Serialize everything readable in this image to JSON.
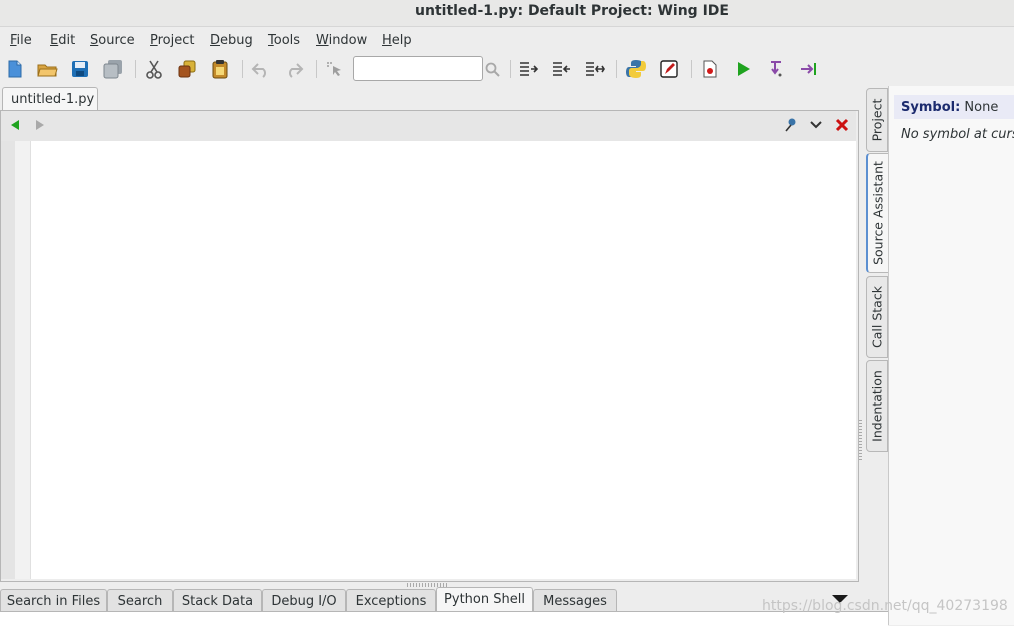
{
  "window": {
    "title": "untitled-1.py: Default Project: Wing IDE"
  },
  "menu": [
    {
      "label": "File",
      "ul": "F",
      "rest": "ile"
    },
    {
      "label": "Edit",
      "ul": "E",
      "rest": "dit"
    },
    {
      "label": "Source",
      "ul": "S",
      "rest": "ource"
    },
    {
      "label": "Project",
      "ul": "P",
      "rest": "roject"
    },
    {
      "label": "Debug",
      "ul": "D",
      "rest": "ebug"
    },
    {
      "label": "Tools",
      "ul": "T",
      "rest": "ools"
    },
    {
      "label": "Window",
      "ul": "W",
      "rest": "indow"
    },
    {
      "label": "Help",
      "ul": "H",
      "rest": "elp"
    }
  ],
  "toolbar": {
    "search_value": "",
    "icons": [
      "new-file-icon",
      "open-folder-icon",
      "save-icon",
      "save-all-icon",
      "cut-icon",
      "copy-icon",
      "paste-icon",
      "undo-icon",
      "redo-icon",
      "select-pointer-icon",
      "search-icon",
      "indent-icon",
      "outdent-icon",
      "indent-toggle-icon",
      "python-icon",
      "edit-icon",
      "breakpoint-icon",
      "run-icon",
      "step-into-icon",
      "step-over-icon"
    ]
  },
  "editor": {
    "tab_label": "untitled-1.py",
    "content": ""
  },
  "side_tabs": [
    {
      "label": "Project",
      "active": false
    },
    {
      "label": "Source Assistant",
      "active": true
    },
    {
      "label": "Call Stack",
      "active": false
    },
    {
      "label": "Indentation",
      "active": false
    }
  ],
  "source_assistant": {
    "symbol_label": "Symbol:",
    "symbol_value": "None",
    "no_symbol_text": "No symbol at curso"
  },
  "bottom_tabs": [
    {
      "label": "Search in Files",
      "active": false
    },
    {
      "label": "Search",
      "active": false
    },
    {
      "label": "Stack Data",
      "active": false
    },
    {
      "label": "Debug I/O",
      "active": false
    },
    {
      "label": "Exceptions",
      "active": false
    },
    {
      "label": "Python Shell",
      "active": true
    },
    {
      "label": "Messages",
      "active": false
    }
  ],
  "watermark": "https://blog.csdn.net/qq_40273198",
  "colors": {
    "accent": "#5b8fd1",
    "run_green": "#1fa31f",
    "close_red": "#cc1111",
    "symbol_bg": "#e9eaf6"
  }
}
